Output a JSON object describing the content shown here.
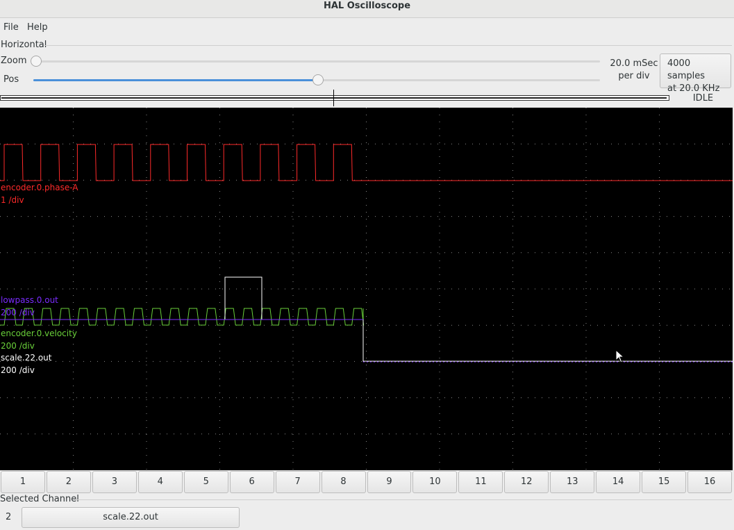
{
  "window": {
    "title": "HAL Oscilloscope"
  },
  "menu": {
    "file": "File",
    "help": "Help"
  },
  "horizontal": {
    "group_label": "Horizontal",
    "zoom_label": "Zoom",
    "zoom_value": 0.0,
    "pos_label": "Pos",
    "pos_value": 0.5,
    "rate_line1": "20.0 mSec",
    "rate_line2": "per div",
    "samples_line1": "4000 samples",
    "samples_line2": "at 20.0 KHz"
  },
  "status": {
    "run_state": "IDLE"
  },
  "colors": {
    "accent": "#4a90d9",
    "scope_bg": "#000000",
    "grid": "#8a8a8a"
  },
  "chart_data": {
    "type": "line",
    "title": "",
    "xlabel": "",
    "ylabel": "",
    "grid": true,
    "divisions": {
      "x": 10,
      "y": 10
    },
    "series": [
      {
        "name": "encoder.0.phase-A",
        "scale": "1 /div",
        "color": "#ff2a2a",
        "description_waveform": "square pulses 0-1",
        "pulse_count": 10
      },
      {
        "name": "lowpass.0.out",
        "scale": "200 /div",
        "color": "#7b2cff"
      },
      {
        "name": "encoder.0.velocity",
        "scale": "200 /div",
        "color": "#6ad13a"
      },
      {
        "name": "scale.22.out",
        "scale": "200 /div",
        "color": "#ffffff"
      }
    ]
  },
  "traces": {
    "t1_name": "encoder.0.phase-A",
    "t1_scale": "1 /div",
    "t2_name": "lowpass.0.out",
    "t2_scale": "200 /div",
    "t3_name": "encoder.0.velocity",
    "t3_scale": "200 /div",
    "t4_name": "scale.22.out",
    "t4_scale": "200 /div"
  },
  "channels": [
    "1",
    "2",
    "3",
    "4",
    "5",
    "6",
    "7",
    "8",
    "9",
    "10",
    "11",
    "12",
    "13",
    "14",
    "15",
    "16"
  ],
  "selected": {
    "group_label": "Selected Channel",
    "number": "2",
    "name": "scale.22.out"
  }
}
